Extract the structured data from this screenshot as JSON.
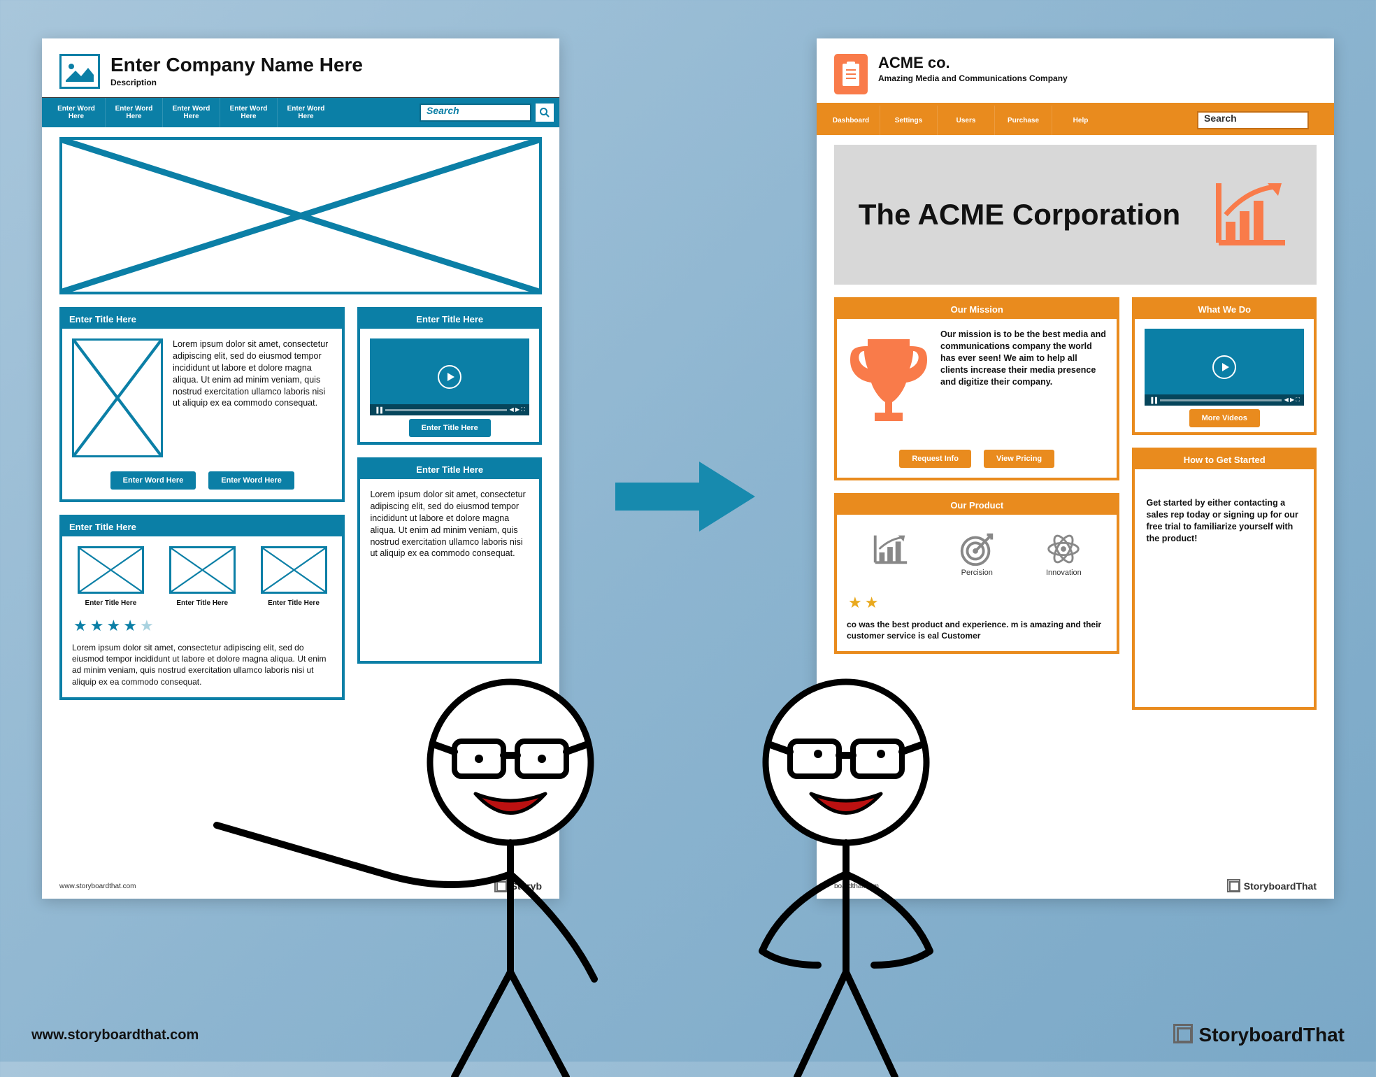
{
  "wireframe": {
    "company": "Enter Company Name Here",
    "subtitle": "Description",
    "nav": [
      "Enter Word Here",
      "Enter Word Here",
      "Enter Word Here",
      "Enter Word Here",
      "Enter Word Here"
    ],
    "search_placeholder": "Search",
    "section1_title": "Enter Title Here",
    "section1_body": "Lorem ipsum dolor sit amet, consectetur adipiscing elit, sed do eiusmod tempor incididunt ut labore et dolore magna aliqua. Ut enim ad minim veniam, quis nostrud exercitation ullamco laboris nisi ut aliquip ex ea commodo consequat.",
    "section1_btn1": "Enter Word Here",
    "section1_btn2": "Enter Word Here",
    "video_title": "Enter Title Here",
    "video_caption": "Enter Title Here",
    "side_title": "Enter Title Here",
    "side_body": "Lorem ipsum dolor sit amet, consectetur adipiscing elit, sed do eiusmod tempor incididunt ut labore et dolore magna aliqua. Ut enim ad minim veniam, quis nostrud exercitation ullamco laboris nisi ut aliquip ex ea commodo consequat.",
    "thumbs_title": "Enter Title Here",
    "thumb_caption": "Enter Title Here",
    "review": "Lorem ipsum dolor sit amet, consectetur adipiscing elit, sed do eiusmod tempor incididunt ut labore et dolore magna aliqua. Ut enim ad minim veniam, quis nostrud exercitation ullamco laboris nisi ut aliquip ex ea commodo consequat.",
    "footer_url": "www.storyboardthat.com"
  },
  "mockup": {
    "company": "ACME co.",
    "subtitle": "Amazing Media and Communications Company",
    "nav": [
      "Dashboard",
      "Settings",
      "Users",
      "Purchase",
      "Help"
    ],
    "search_placeholder": "Search",
    "hero": "The ACME Corporation",
    "mission_title": "Our Mission",
    "mission_body": "Our mission is to be the best media and communications company the world has ever seen! We aim to help all clients increase their media presence and digitize their company.",
    "btn_request": "Request Info",
    "btn_pricing": "View Pricing",
    "what_title": "What We Do",
    "video_caption": "More Videos",
    "howto_title": "How to Get Started",
    "howto_body": "Get started by either contacting a sales rep today or signing up for our free trial to familiarize yourself with the product!",
    "product_title": "Our Product",
    "products": [
      "",
      "Percision",
      "Innovation"
    ],
    "review": "co was the best product and experience. m is amazing and their customer service is eal Customer",
    "footer_url": "boardthat.com"
  },
  "outer": {
    "url": "www.storyboardthat.com",
    "brand": "StoryboardThat"
  },
  "colors": {
    "teal": "#0b7fa6",
    "orange": "#e98b1e",
    "coral": "#f97b4a"
  }
}
